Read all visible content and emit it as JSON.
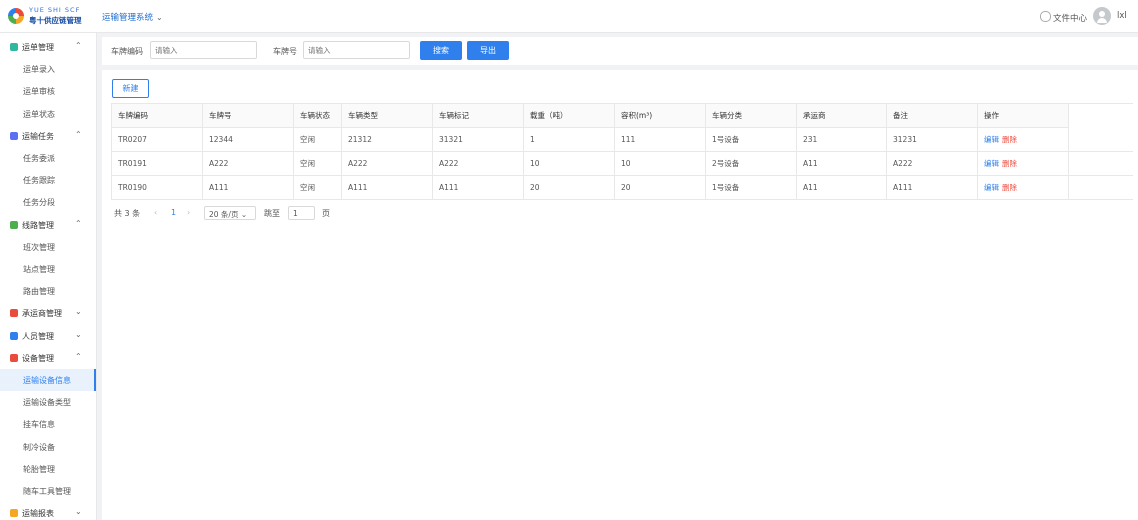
{
  "header": {
    "logo_en": "YUE SHI SCF",
    "logo_cn": "粤十供应链管理",
    "system_title": "运输管理系统",
    "file_center": "文件中心",
    "username": "lxl"
  },
  "sidebar": {
    "groups": [
      {
        "label": "运单管理",
        "color": "#2fb8a0",
        "items": [
          "运单录入",
          "运单审核",
          "运单状态"
        ]
      },
      {
        "label": "运输任务",
        "color": "#5b6ff2",
        "items": [
          "任务委派",
          "任务跟踪",
          "任务分段"
        ]
      },
      {
        "label": "线路管理",
        "color": "#4cae4c",
        "items": [
          "班次管理",
          "站点管理",
          "路由管理"
        ]
      },
      {
        "label": "承运商管理",
        "color": "#e94b3c",
        "items": []
      },
      {
        "label": "人员管理",
        "color": "#2f80ed",
        "items": []
      },
      {
        "label": "设备管理",
        "color": "#e94b3c",
        "items": [
          "运输设备信息",
          "运输设备类型",
          "挂车信息",
          "制冷设备",
          "轮胎管理",
          "随车工具管理"
        ]
      },
      {
        "label": "运输报表",
        "color": "#f5a623",
        "items": []
      }
    ],
    "active_item": "运输设备信息"
  },
  "search": {
    "plate_code_label": "车牌编码",
    "plate_code_placeholder": "请输入",
    "plate_no_label": "车牌号",
    "plate_no_placeholder": "请输入",
    "search_button": "搜索",
    "export_button": "导出"
  },
  "toolbar": {
    "new_button": "新建"
  },
  "table": {
    "columns": [
      "车牌编码",
      "车牌号",
      "车辆状态",
      "车辆类型",
      "车辆标记",
      "载重（吨）",
      "容积(m³)",
      "车辆分类",
      "承运商",
      "备注",
      "操作"
    ],
    "rows": [
      [
        "TR0207",
        "12344",
        "空闲",
        "21312",
        "31321",
        "1",
        "111",
        "1号设备",
        "231",
        "31231"
      ],
      [
        "TR0191",
        "A222",
        "空闲",
        "A222",
        "A222",
        "10",
        "10",
        "2号设备",
        "A11",
        "A222"
      ],
      [
        "TR0190",
        "A111",
        "空闲",
        "A111",
        "A111",
        "20",
        "20",
        "1号设备",
        "A11",
        "A111"
      ]
    ],
    "edit_label": "编辑",
    "delete_label": "删除"
  },
  "pagination": {
    "total": "共 3 条",
    "prev": "‹",
    "current_page": "1",
    "next": "›",
    "page_size": "20 条/页",
    "goto_label": "跳至",
    "goto_value": "1",
    "page_suffix": "页"
  }
}
